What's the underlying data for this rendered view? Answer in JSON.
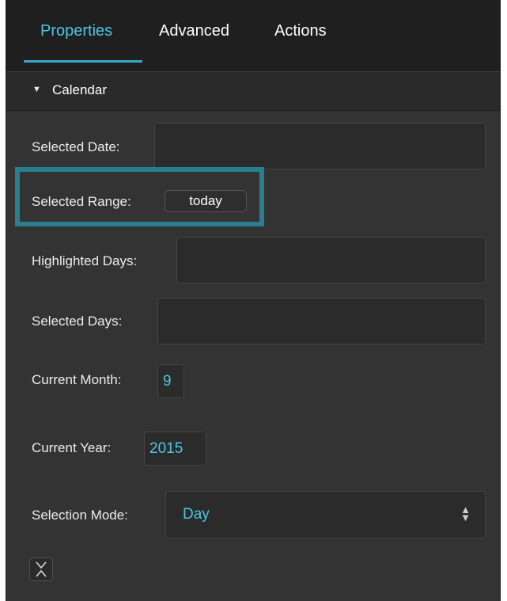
{
  "tabs": [
    {
      "label": "Properties",
      "active": true
    },
    {
      "label": "Advanced",
      "active": false
    },
    {
      "label": "Actions",
      "active": false
    }
  ],
  "section": {
    "title": "Calendar",
    "expanded": true
  },
  "fields": {
    "selected_date": {
      "label": "Selected Date:",
      "value": ""
    },
    "selected_range": {
      "label": "Selected Range:",
      "value": "today"
    },
    "highlighted_days": {
      "label": "Highlighted Days:",
      "value": ""
    },
    "selected_days": {
      "label": "Selected Days:",
      "value": ""
    },
    "current_month": {
      "label": "Current Month:",
      "value": "9"
    },
    "current_year": {
      "label": "Current Year:",
      "value": "2015"
    },
    "selection_mode": {
      "label": "Selection Mode:",
      "value": "Day"
    }
  },
  "colors": {
    "accent": "#4ec6e6",
    "highlight_border": "#2a7e8e",
    "panel_bg": "#333333",
    "tabbar_bg": "#1f1f1f"
  }
}
